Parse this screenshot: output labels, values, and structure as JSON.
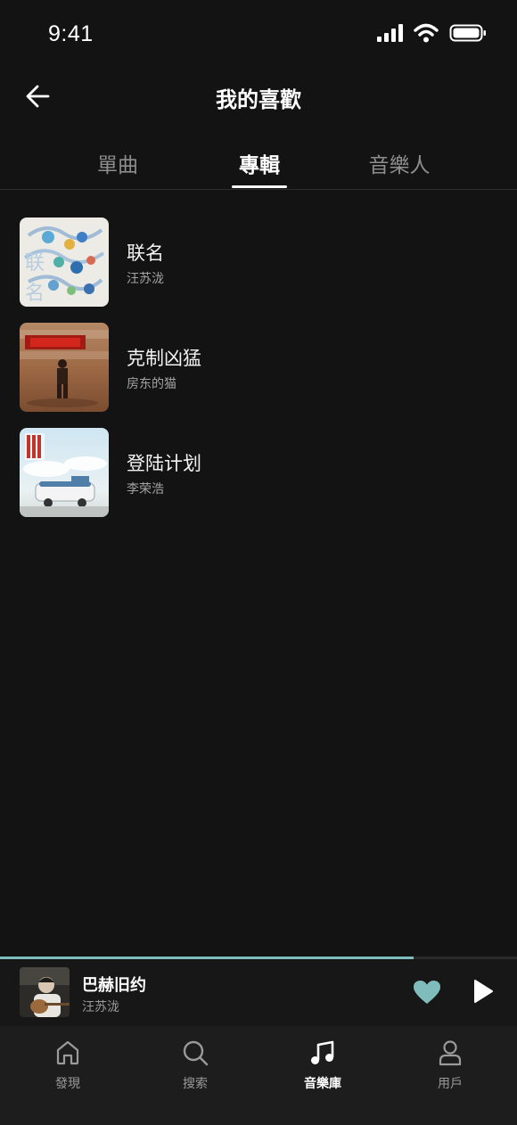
{
  "status_bar": {
    "time": "9:41"
  },
  "header": {
    "title": "我的喜歡",
    "back_icon": "arrow-left-icon"
  },
  "tabs": [
    {
      "label": "單曲",
      "active": false
    },
    {
      "label": "專輯",
      "active": true
    },
    {
      "label": "音樂人",
      "active": false
    }
  ],
  "albums": [
    {
      "title": "联名",
      "artist": "汪苏泷"
    },
    {
      "title": "克制凶猛",
      "artist": "房东的猫"
    },
    {
      "title": "登陆计划",
      "artist": "李荣浩"
    }
  ],
  "now_playing": {
    "title": "巴赫旧约",
    "artist": "汪苏泷",
    "progress": 0.8,
    "liked": true,
    "accent_color": "#7fbcbc"
  },
  "bottom_nav": [
    {
      "label": "發現",
      "icon": "home-icon",
      "active": false
    },
    {
      "label": "搜索",
      "icon": "search-icon",
      "active": false
    },
    {
      "label": "音樂庫",
      "icon": "music-note-icon",
      "active": true
    },
    {
      "label": "用戶",
      "icon": "user-icon",
      "active": false
    }
  ]
}
